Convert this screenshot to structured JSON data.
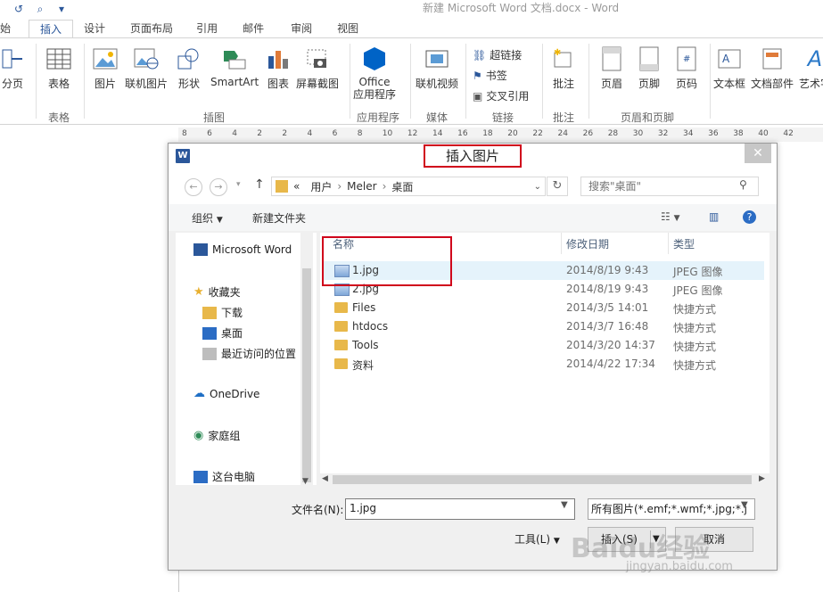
{
  "window": {
    "title": "新建 Microsoft Word 文档.docx - Word"
  },
  "ribbon": {
    "tabs": [
      "始",
      "插入",
      "设计",
      "页面布局",
      "引用",
      "邮件",
      "审阅",
      "视图"
    ],
    "active_tab": "插入",
    "buttons": {
      "page_break": "分页",
      "table": "表格",
      "picture": "图片",
      "online_picture": "联机图片",
      "shapes": "形状",
      "smartart": "SmartArt",
      "chart": "图表",
      "screenshot": "屏幕截图",
      "office_apps_line1": "Office",
      "office_apps_line2": "应用程序",
      "online_video": "联机视频",
      "hyperlink": "超链接",
      "bookmark": "书签",
      "cross_ref": "交叉引用",
      "comment": "批注",
      "header": "页眉",
      "footer": "页脚",
      "page_number": "页码",
      "textbox": "文本框",
      "quick_parts": "文档部件",
      "wordart": "艺术字"
    },
    "groups": {
      "tables": "表格",
      "illustrations": "插图",
      "apps": "应用程序",
      "media": "媒体",
      "links": "链接",
      "comments": "批注",
      "header_footer": "页眉和页脚"
    }
  },
  "ruler": {
    "ticks": [
      "8",
      "6",
      "4",
      "2",
      "2",
      "4",
      "6",
      "8",
      "10",
      "12",
      "14",
      "16",
      "18",
      "20",
      "22",
      "24",
      "26",
      "28",
      "30",
      "32",
      "34",
      "36",
      "38",
      "40",
      "42"
    ]
  },
  "dialog": {
    "title": "插入图片",
    "address": {
      "prefix": "«",
      "segments": [
        "用户",
        "Meler",
        "桌面"
      ]
    },
    "search_placeholder": "搜索\"桌面\"",
    "toolbar": {
      "organize": "组织",
      "new_folder": "新建文件夹"
    },
    "nav": {
      "word": "Microsoft Word",
      "favorites": "收藏夹",
      "downloads": "下载",
      "desktop": "桌面",
      "recent": "最近访问的位置",
      "onedrive": "OneDrive",
      "homegroup": "家庭组",
      "this_pc": "这台电脑"
    },
    "columns": {
      "name": "名称",
      "modified": "修改日期",
      "type": "类型"
    },
    "files": [
      {
        "name": "1.jpg",
        "date": "2014/8/19 9:43",
        "type": "JPEG 图像",
        "kind": "image",
        "selected": true
      },
      {
        "name": "2.jpg",
        "date": "2014/8/19 9:43",
        "type": "JPEG 图像",
        "kind": "image",
        "selected": false
      },
      {
        "name": "Files",
        "date": "2014/3/5 14:01",
        "type": "快捷方式",
        "kind": "folder",
        "selected": false
      },
      {
        "name": "htdocs",
        "date": "2014/3/7 16:48",
        "type": "快捷方式",
        "kind": "folder",
        "selected": false
      },
      {
        "name": "Tools",
        "date": "2014/3/20 14:37",
        "type": "快捷方式",
        "kind": "folder",
        "selected": false
      },
      {
        "name": "资料",
        "date": "2014/4/22 17:34",
        "type": "快捷方式",
        "kind": "folder",
        "selected": false
      }
    ],
    "filename_label": "文件名(N):",
    "filename_value": "1.jpg",
    "filter_value": "所有图片(*.emf;*.wmf;*.jpg;*.j",
    "tools_label": "工具(L)",
    "insert_label": "插入(S)",
    "cancel_label": "取消"
  },
  "watermark": {
    "main": "Baidu经验",
    "sub": "jingyan.baidu.com"
  },
  "colors": {
    "accent": "#2b579a",
    "highlight_box": "#d0021b",
    "selection": "#e5f3fb"
  }
}
